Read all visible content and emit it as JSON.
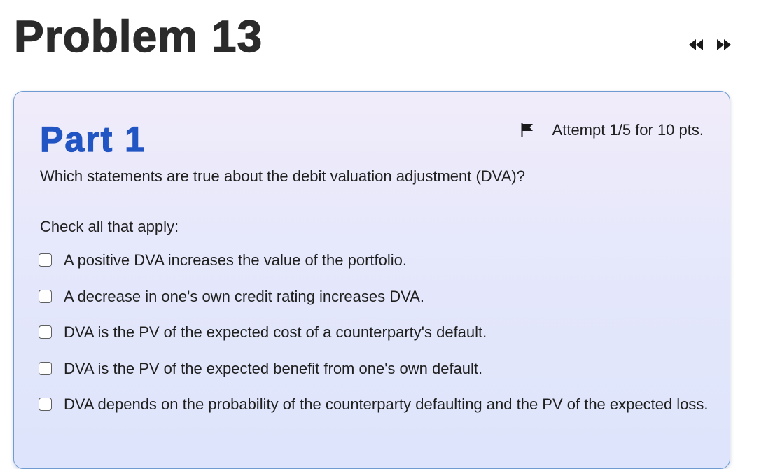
{
  "header": {
    "title": "Problem 13",
    "prev_icon": "rewind-double-left-icon",
    "next_icon": "fast-forward-double-right-icon"
  },
  "part": {
    "title": "Part 1",
    "attempt_text": "Attempt 1/5 for 10 pts.",
    "flag_icon": "flag-icon",
    "question": "Which statements are true about the debit valuation adjustment (DVA)?",
    "instruction": "Check all that apply:",
    "options": [
      {
        "label": "A positive DVA increases the value of the portfolio.",
        "checked": false
      },
      {
        "label": "A decrease in one's own credit rating increases DVA.",
        "checked": false
      },
      {
        "label": "DVA is the PV of the expected cost of a counterparty's default.",
        "checked": false
      },
      {
        "label": "DVA is the PV of the expected benefit from one's own default.",
        "checked": false
      },
      {
        "label": "DVA depends on the probability of the counterparty defaulting and the PV of the expected loss.",
        "checked": false
      }
    ]
  },
  "colors": {
    "part_title": "#2255c4",
    "card_border": "#6e9bd2",
    "title_text": "#2b2b2b"
  }
}
